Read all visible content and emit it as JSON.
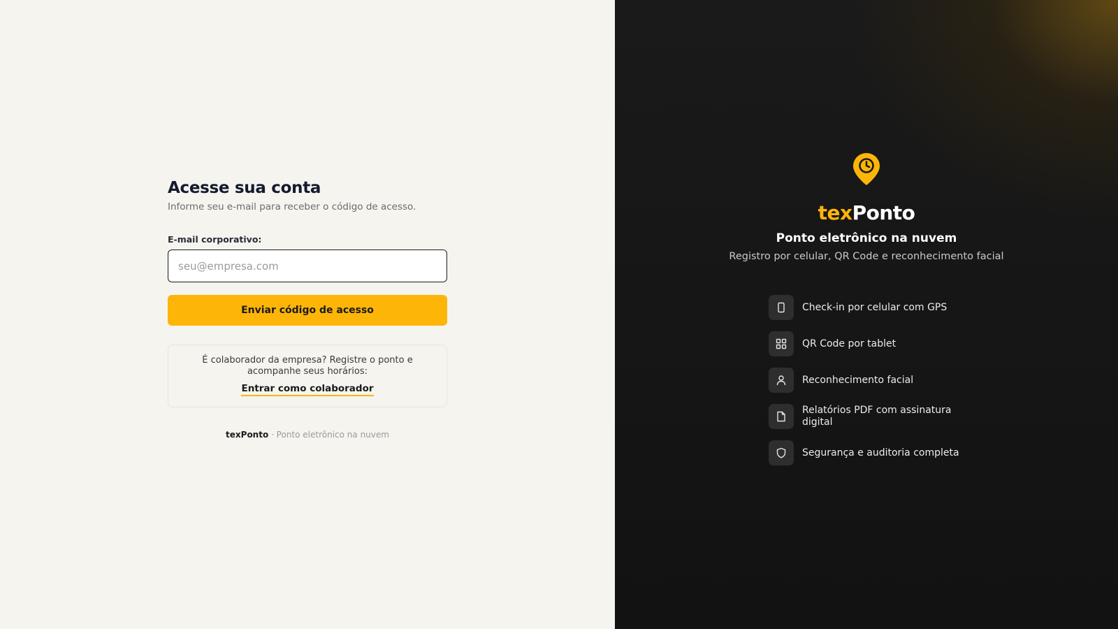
{
  "login": {
    "title": "Acesse sua conta",
    "subtitle": "Informe seu e-mail para receber o código de acesso.",
    "email_label": "E-mail corporativo:",
    "email_placeholder": "seu@empresa.com",
    "email_value": "",
    "submit_label": "Enviar código de acesso",
    "collaborator_text": "É colaborador da empresa? Registre o ponto e acompanhe seus horários:",
    "collaborator_link": "Entrar como colaborador",
    "footer_brand": "texPonto",
    "footer_sep": " · ",
    "footer_tagline": "Ponto eletrônico na nuvem"
  },
  "brand": {
    "logo_tex": "tex",
    "logo_ponto": "Ponto",
    "tagline": "Ponto eletrônico na nuvem",
    "description": "Registro por celular, QR Code e reconhecimento facial",
    "icon": "location-clock-pin-icon"
  },
  "features": [
    {
      "icon": "smartphone-icon",
      "label": "Check-in por celular com GPS"
    },
    {
      "icon": "qr-grid-icon",
      "label": "QR Code por tablet"
    },
    {
      "icon": "user-icon",
      "label": "Reconhecimento facial"
    },
    {
      "icon": "document-icon",
      "label": "Relatórios PDF com assinatura digital"
    },
    {
      "icon": "shield-icon",
      "label": "Segurança e auditoria completa"
    }
  ],
  "colors": {
    "accent": "#fdb508",
    "left_bg": "#f5f4ef",
    "right_bg": "#141414",
    "title_text": "#141a2e"
  }
}
